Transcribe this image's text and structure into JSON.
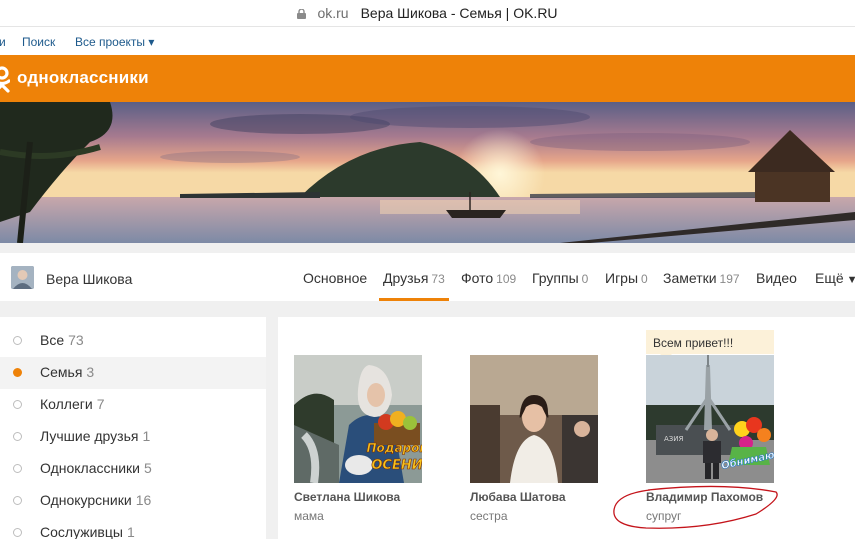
{
  "browser": {
    "domain": "ok.ru",
    "title": "Вера Шикова - Семья | OK.RU"
  },
  "top_links": {
    "cut_left": "и",
    "search": "Поиск",
    "all_projects": "Все проекты ▾"
  },
  "header": {
    "logo_text": "одноклассники",
    "color": "#ee8208"
  },
  "profile": {
    "name": "Вера Шикова"
  },
  "tabs": [
    {
      "label": "Основное",
      "count": ""
    },
    {
      "label": "Друзья",
      "count": "73"
    },
    {
      "label": "Фото",
      "count": "109"
    },
    {
      "label": "Группы",
      "count": "0"
    },
    {
      "label": "Игры",
      "count": "0"
    },
    {
      "label": "Заметки",
      "count": "197"
    },
    {
      "label": "Видео",
      "count": ""
    },
    {
      "label": "Ещё",
      "count": ""
    }
  ],
  "active_tab": "Друзья",
  "sidebar": [
    {
      "label": "Все",
      "count": "73"
    },
    {
      "label": "Семья",
      "count": "3"
    },
    {
      "label": "Коллеги",
      "count": "7"
    },
    {
      "label": "Лучшие друзья",
      "count": "1"
    },
    {
      "label": "Одноклассники",
      "count": "5"
    },
    {
      "label": "Однокурсники",
      "count": "16"
    },
    {
      "label": "Сослуживцы",
      "count": "1"
    }
  ],
  "active_sidebar": "Семья",
  "friends": [
    {
      "name": "Светлана Шикова",
      "relation": "мама",
      "sticker": [
        "Подарок",
        "ОСЕНИ"
      ]
    },
    {
      "name": "Любава Шатова",
      "relation": "сестра"
    },
    {
      "name": "Владимир Пахомов",
      "relation": "супруг",
      "status": "Всем привет!!!",
      "photo_sign": "АЗИЯ",
      "sticker": "Обнимаю!"
    }
  ],
  "annotation_color": "#c4141b"
}
